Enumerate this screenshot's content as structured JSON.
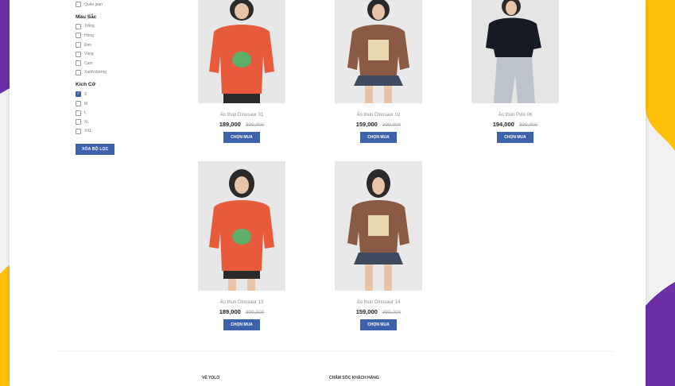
{
  "filters": {
    "top_item": "Quần jean",
    "color_title": "Màu Sắc",
    "colors": [
      "Trắng",
      "Hồng",
      "Đen",
      "Vàng",
      "Cam",
      "Xanh dương"
    ],
    "size_title": "Kích Cỡ",
    "sizes": [
      "S",
      "M",
      "L",
      "XL",
      "XXL"
    ],
    "size_checked": "S",
    "clear_label": "XÓA BỘ LỌC"
  },
  "products": [
    {
      "name": "Áo thun Dinosaur 01",
      "price": "189,000",
      "old_price": "399,000",
      "button": "CHỌN MUA"
    },
    {
      "name": "Áo thun Dinosaur 02",
      "price": "159,000",
      "old_price": "399,000",
      "button": "CHỌN MUA"
    },
    {
      "name": "Áo thun Polo 06",
      "price": "194,000",
      "old_price": "399,000",
      "button": "CHỌN MUA"
    },
    {
      "name": "Áo thun Dinosaur 13",
      "price": "189,000",
      "old_price": "399,000",
      "button": "CHỌN MUA"
    },
    {
      "name": "Áo thun Dinosaur 14",
      "price": "159,000",
      "old_price": "399,000",
      "button": "CHỌN MUA"
    }
  ],
  "footer": {
    "col1": "VỀ YOLO",
    "col2": "CHĂM SÓC KHÁCH HÀNG"
  },
  "colors": {
    "accent": "#3d62ab",
    "purple": "#6d2fa6",
    "yellow": "#ffc107"
  }
}
